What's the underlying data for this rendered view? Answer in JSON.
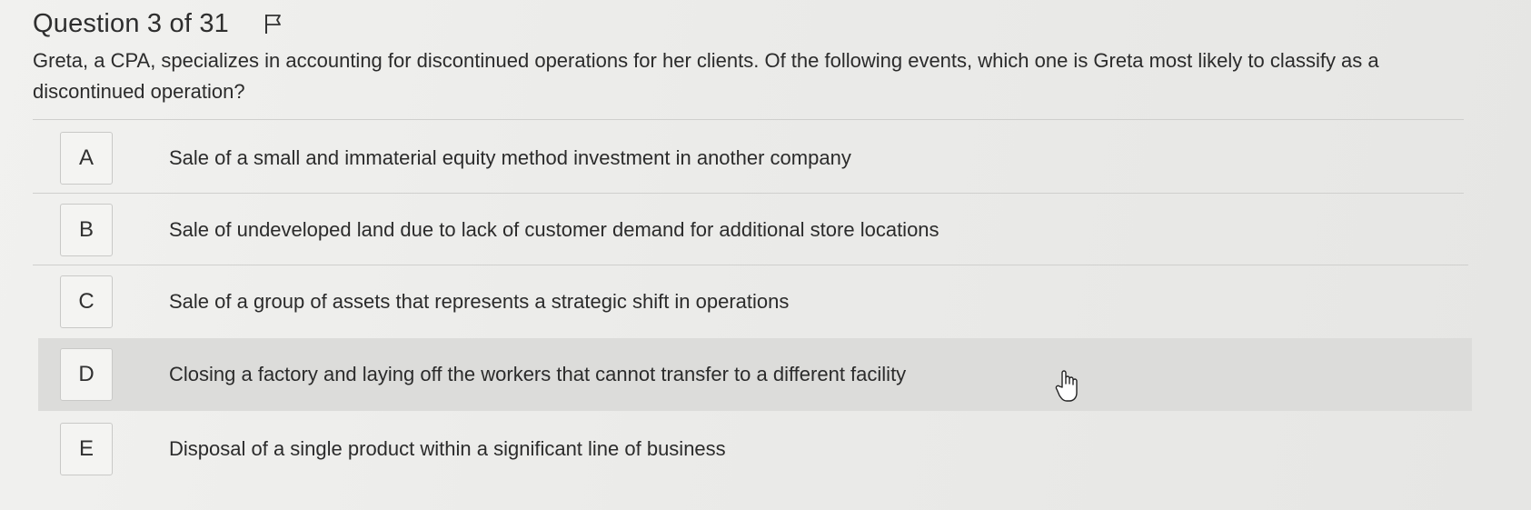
{
  "header": {
    "title": "Question 3 of 31",
    "flag_icon": "flag-icon"
  },
  "question": {
    "text": "Greta, a CPA, specializes in accounting for discontinued operations for her clients. Of the following events, which one is Greta most likely to classify as a discontinued operation?"
  },
  "options": [
    {
      "letter": "A",
      "text": "Sale of a small and immaterial equity method investment in another company"
    },
    {
      "letter": "B",
      "text": "Sale of undeveloped land due to lack of customer demand for additional store locations"
    },
    {
      "letter": "C",
      "text": "Sale of a group of assets that represents a strategic shift in operations"
    },
    {
      "letter": "D",
      "text": "Closing a factory and laying off the workers that cannot transfer to a different facility",
      "hovered": true
    },
    {
      "letter": "E",
      "text": "Disposal of a single product within a significant line of business"
    }
  ],
  "cursor_icon": "hand-pointer-icon",
  "colors": {
    "background": "#e9e9e7",
    "hover_row": "#dcdcda",
    "text": "#2b2b2b"
  }
}
